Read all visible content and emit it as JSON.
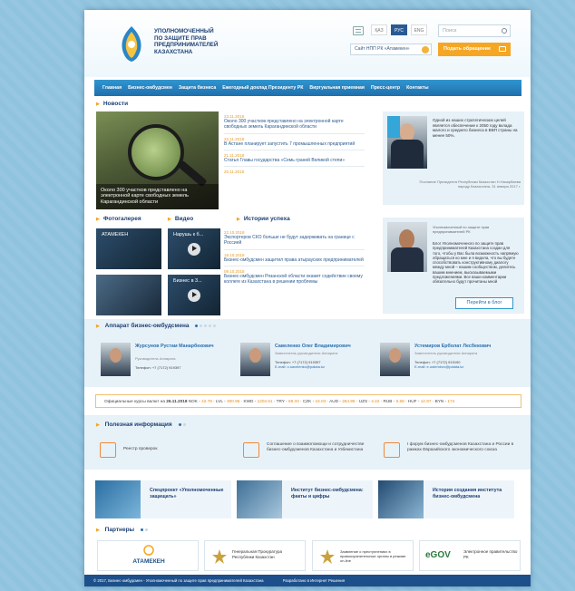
{
  "header": {
    "logo_lines": [
      "УПОЛНОМОЧЕННЫЙ",
      "ПО ЗАЩИТЕ ПРАВ",
      "ПРЕДПРИНИМАТЕЛЕЙ",
      "КАЗАХСТАНА"
    ],
    "langs": [
      {
        "label": "ҚАЗ"
      },
      {
        "label": "РУС"
      },
      {
        "label": "ENG"
      }
    ],
    "active_lang": "РУС",
    "search_placeholder": "Поиск",
    "npp_link": "Сайт НПП РК «Атамекен»",
    "appeal_button": "Подать обращение"
  },
  "nav": [
    "Главная",
    "Бизнес-омбудсмен",
    "Защита бизнеса",
    "Ежегодный доклад Президенту РК",
    "Виртуальная приемная",
    "Пресс-центр",
    "Контакты"
  ],
  "news": {
    "title": "Новости",
    "hero_caption": "Около 300 участков представлено на электронной карте свободных земель Карагандинской области",
    "items": [
      {
        "date": "23.11.2018",
        "text": "Около 300 участков представлено на электронной карте свободных земель Карагандинской области"
      },
      {
        "date": "22.11.2018",
        "text": "В Астане планирует запустить 7 промышленных предприятий"
      },
      {
        "date": "21.11.2018",
        "text": "Статья Главы государства «Семь граней Великой степи»"
      },
      {
        "date": "20.11.2018",
        "text": ""
      }
    ]
  },
  "quote": {
    "text": "Одной из наших стратегических целей является обеспечение к 2050 году вклада малого и среднего бизнеса в ВВП страны на менее 50%.",
    "signature": "Послание Президента Республики Казахстан Н.Назарбаева народу Казахстана, 31 января 2017 г."
  },
  "media": {
    "photo_title": "Фотогалерея",
    "video_title": "Видео",
    "photo_label": "АТАМЕКЕН",
    "video_labels": [
      "Нарушь к б...",
      "Бизнес в 3..."
    ]
  },
  "stories": {
    "title": "Истории успеха",
    "items": [
      {
        "date": "22.10.2018",
        "text": "Экспортеров СКО больше не будут задерживать на границе с Россией"
      },
      {
        "date": "18.10.2018",
        "text": "Бизнес-омбудсмен защитил права атырауских предпринимателей"
      },
      {
        "date": "09.10.2018",
        "text": "Бизнес-омбудсмен Рязанской области окажет содействие своему коллеге из Казахстана в решении проблемы"
      }
    ]
  },
  "blog": {
    "role": "Уполномоченный по защите прав предпринимателей РК",
    "text": "Блог Уполномоченного по защите прав предпринимателей Казахстана создан для того, чтобы у Вас была возможность напрямую обращаться ко мне и я видела, что вы будете способствовать конструктивному диалогу между мной – нашим сообществом, делитесь вашим мнением, высказываемыми предложениями. Все ваши комментарии обязательно будут прочитаны мной",
    "button": "Перейти в блог"
  },
  "apparat": {
    "title": "Аппарат бизнес-омбудсмена",
    "people": [
      {
        "name": "Журсунов Рустам Манарбекович",
        "role": "Руководитель Аппарата",
        "phone": "Телефон: +7 (7172) 919397",
        "email": ""
      },
      {
        "name": "Савеленко Олег Владимирович",
        "role": "Заместитель руководителя Аппарата",
        "phone": "Телефон: +7 (7172) 919397",
        "email": "E-mail: o.savelenko@palata.kz"
      },
      {
        "name": "Устемиров Ерболат Лесбекович",
        "role": "Заместитель руководителя Аппарата",
        "phone": "Телефон: +7 (7172) 919190",
        "email": "E-mail: e.ustemirov@palata.kz"
      }
    ]
  },
  "rates": {
    "label": "Официальные курсы валют на",
    "date": "26.11.2018",
    "items": [
      {
        "code": "NOK",
        "value": "42.78"
      },
      {
        "code": "LVL",
        "value": "300.96"
      },
      {
        "code": "KWD",
        "value": "1204.51"
      },
      {
        "code": "TRY",
        "value": "69.33"
      },
      {
        "code": "CZK",
        "value": "16.03"
      },
      {
        "code": "AUD",
        "value": "264.95"
      },
      {
        "code": "UZS",
        "value": "4.42"
      },
      {
        "code": "RUB",
        "value": "5.58"
      },
      {
        "code": "HUF",
        "value": "12.97"
      },
      {
        "code": "BYN",
        "value": "174"
      }
    ]
  },
  "useful": {
    "title": "Полезная информация",
    "items": [
      "Реестр проверок",
      "Соглашение о взаимопомощи и сотрудничестве бизнес-омбудсменов Казахстана и Узбекистана",
      "I форум бизнес-омбудсменов Казахстана и России в рамках Евразийского экономического союза"
    ]
  },
  "cards": [
    "Спецпроект «Уполномоченные защищать»",
    "Институт бизнес-омбудсмена: факты и цифры",
    "История создания института бизнес-омбудсмена"
  ],
  "partners": {
    "title": "Партнеры",
    "items": [
      {
        "name": "АТАМЕКЕН"
      },
      {
        "name": "Генеральная Прокуратура Республики Казахстан"
      },
      {
        "name": "Заявление о преступлениях в правоохранительные органы в режиме on-line"
      },
      {
        "name": "Электронное правительство РК"
      }
    ],
    "egov_logo": "eGOV"
  },
  "footer": {
    "copyright": "© 2017, Бизнес-омбудсмен - Уполномоченный по защите прав предпринимателей Казахстана",
    "developer": "Разработано в Интернет Решения"
  },
  "colors": {
    "accent": "#f5a623",
    "nav_blue": "#1f6fae",
    "link_blue": "#2a6fb0",
    "dark_blue": "#1c3f73"
  }
}
